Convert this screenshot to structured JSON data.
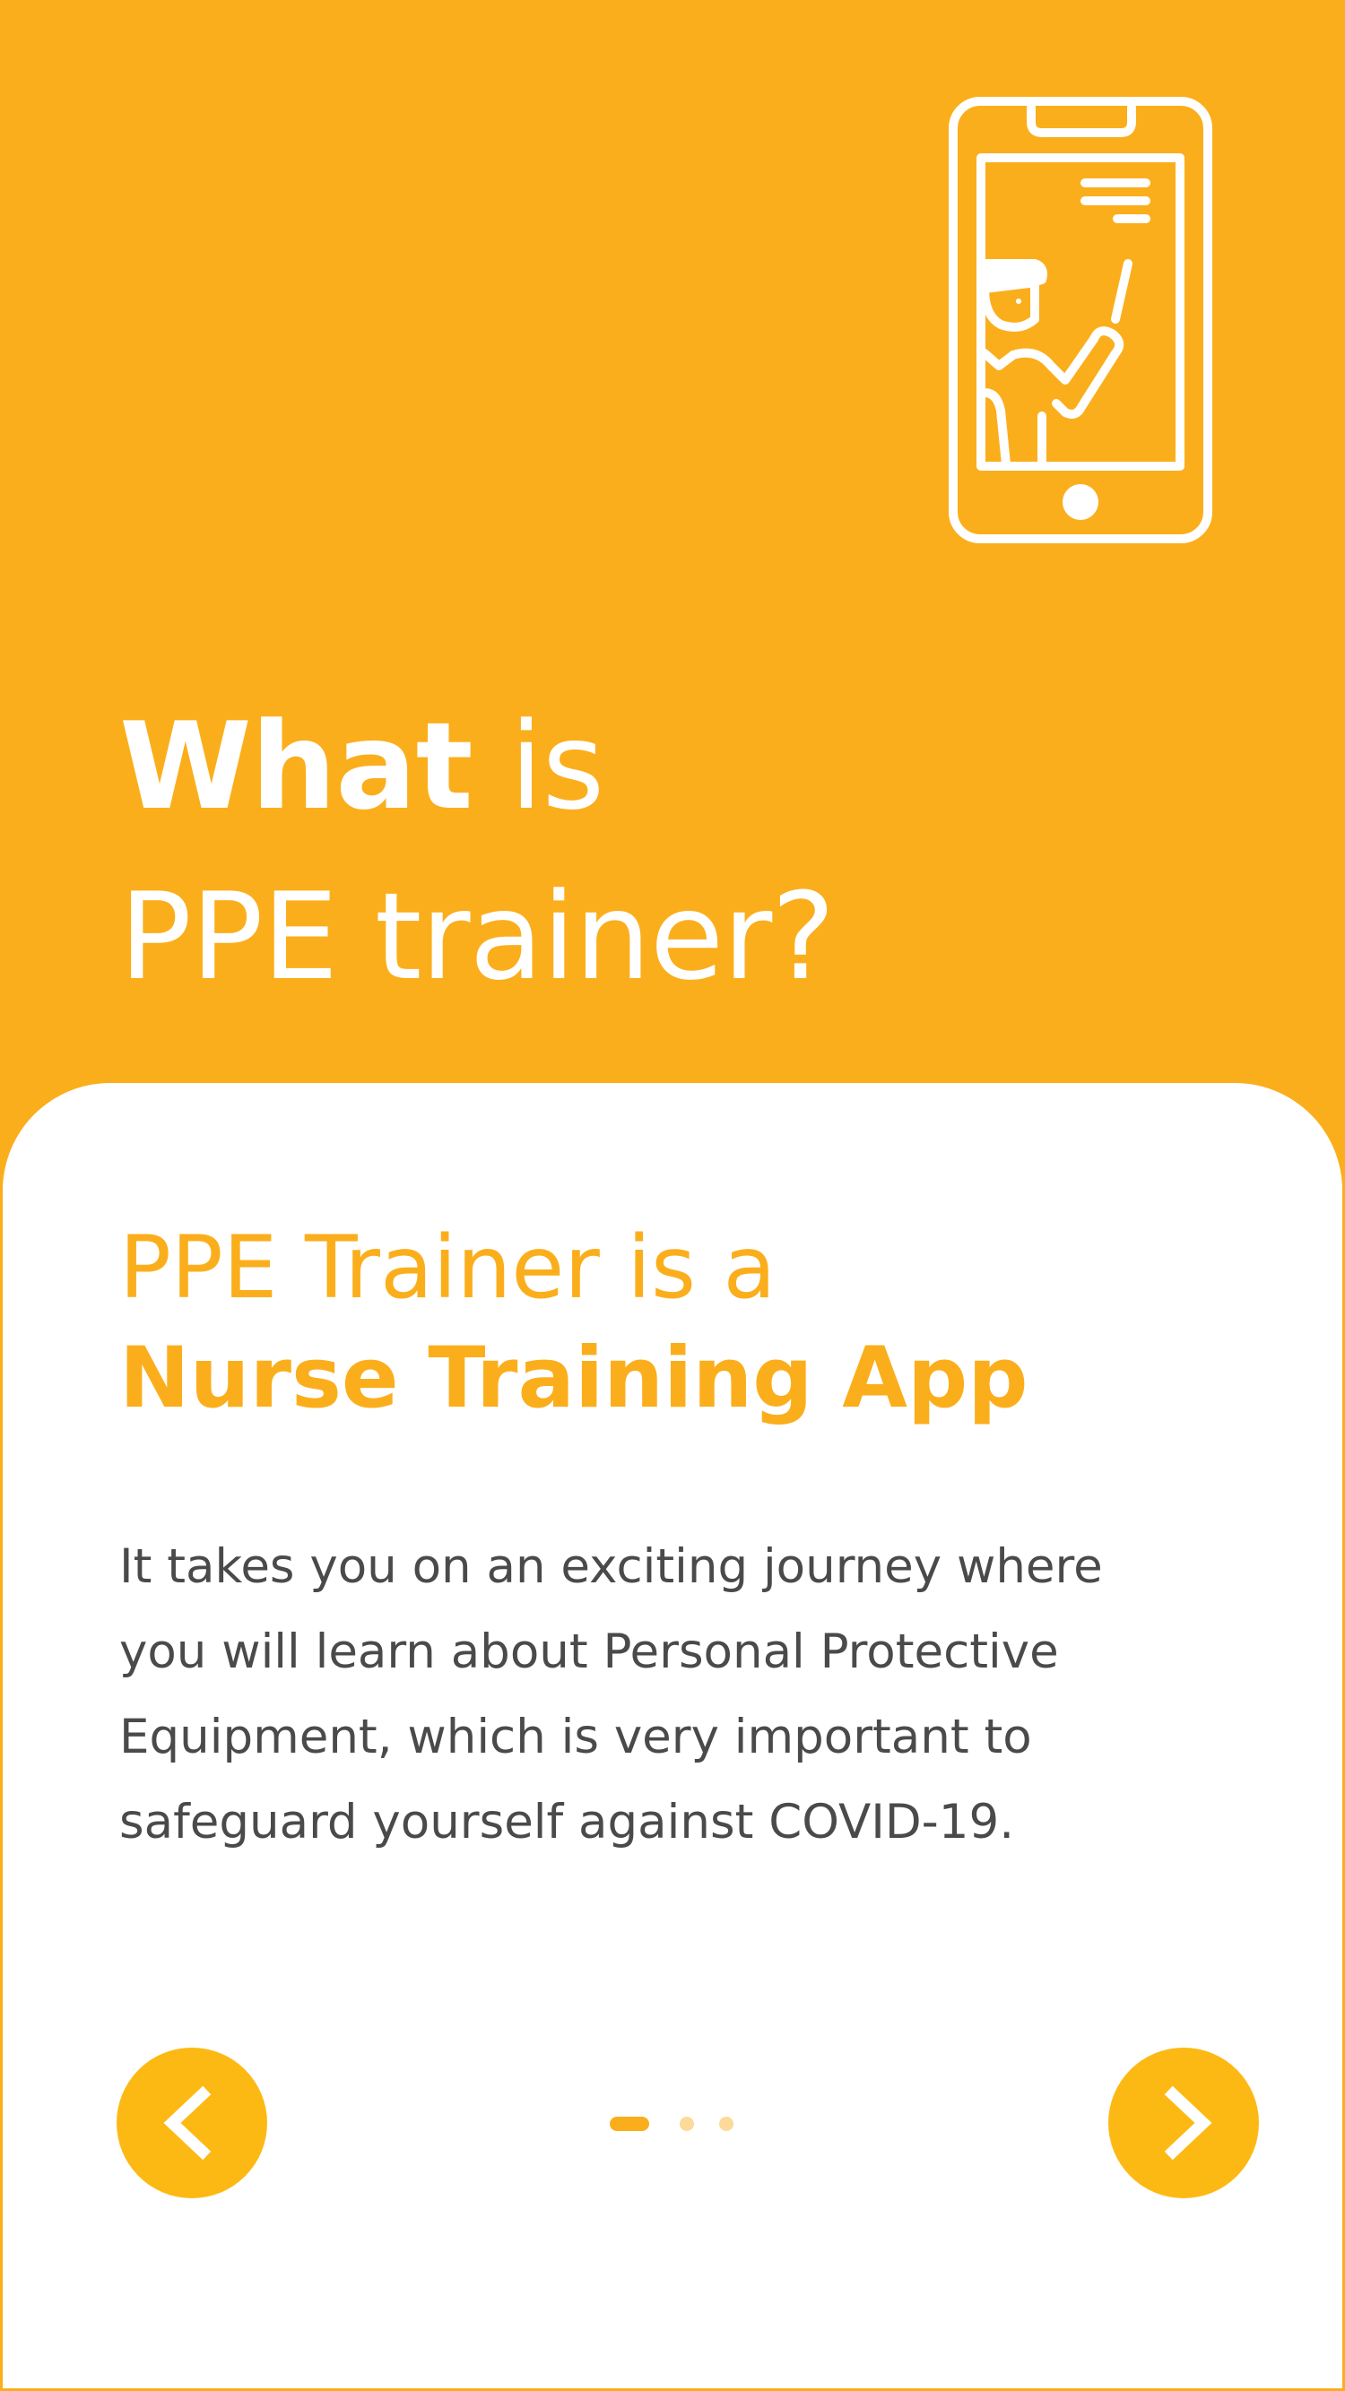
{
  "hero": {
    "title_bold": "What",
    "title_rest": " is",
    "title_line2": "PPE trainer?"
  },
  "card": {
    "heading_line1": "PPE Trainer is a",
    "heading_line2": "Nurse Training App",
    "body": "It takes you on an exciting journey where you will learn about Personal Protective Equipment, which is very important to safeguard yourself against COVID-19."
  },
  "navigation": {
    "prev_icon": "chevron-left-icon",
    "next_icon": "chevron-right-icon",
    "page_count": 3,
    "current_page": 1
  },
  "colors": {
    "brand": "#FBAE1C",
    "button": "#FDB913",
    "card": "#FFFFFF",
    "body_text": "#4A4A4A"
  },
  "illustration": {
    "icon": "smartphone-trainer-icon"
  }
}
